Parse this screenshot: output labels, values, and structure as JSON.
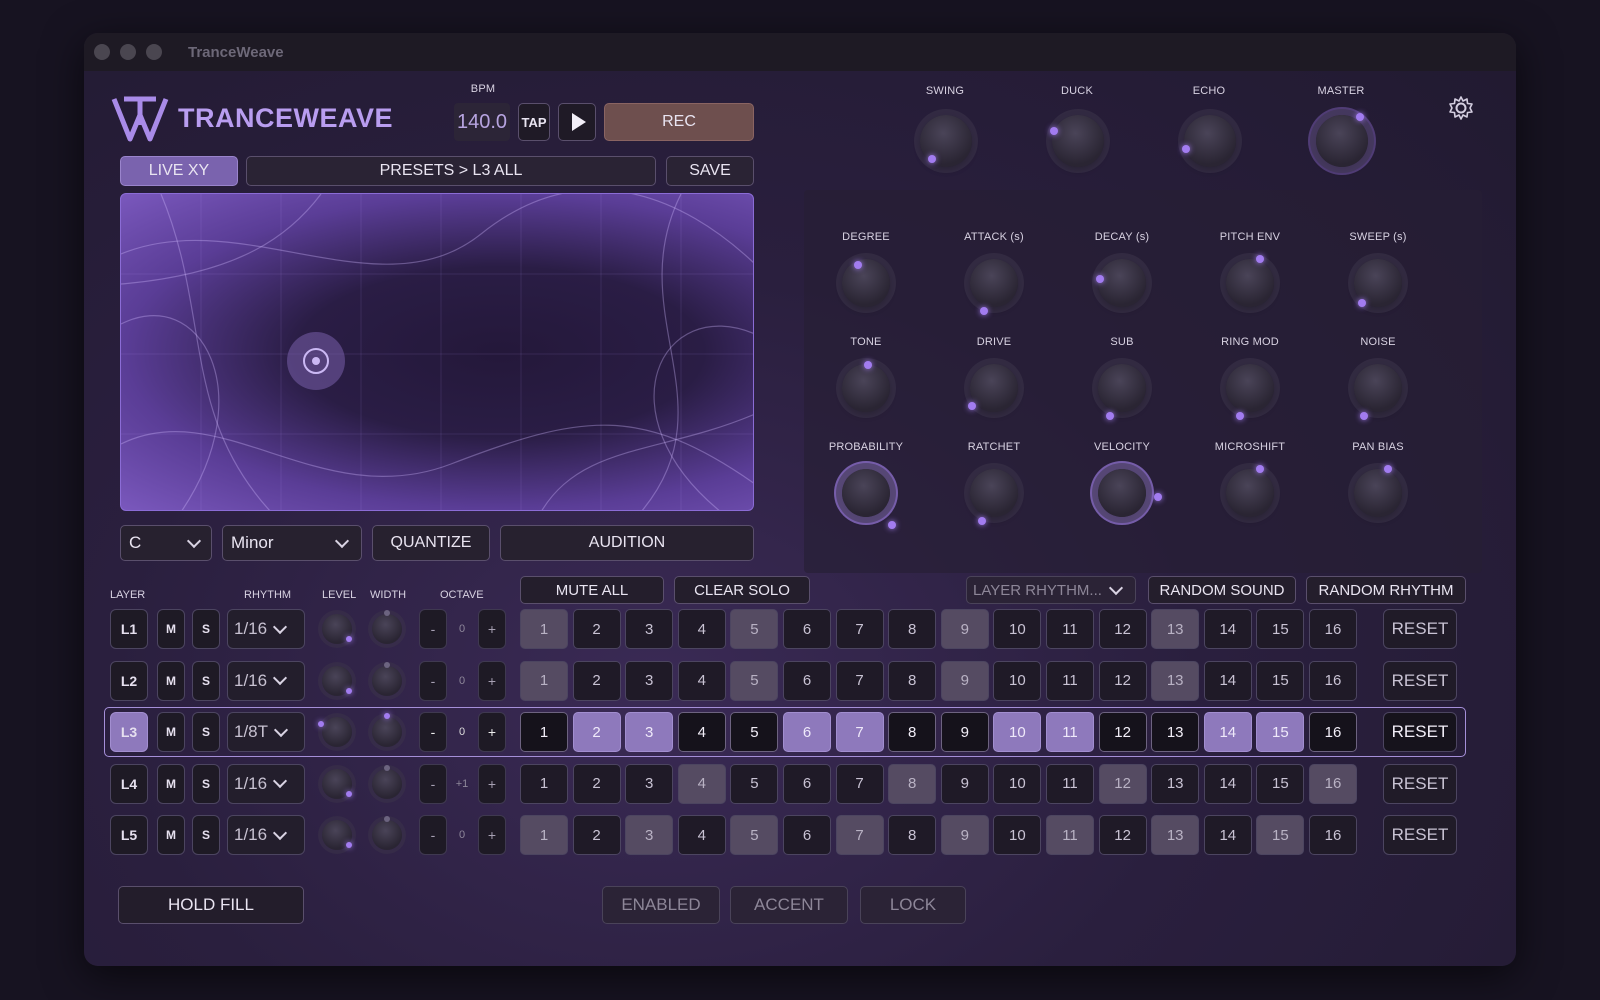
{
  "window": {
    "title": "TranceWeave"
  },
  "brand": {
    "name": "TRANCEWEAVE"
  },
  "transport": {
    "bpm_label": "BPM",
    "bpm_value": "140.0",
    "tap_label": "TAP",
    "rec_label": "REC"
  },
  "mode": {
    "live_xy_label": "LIVE XY",
    "preset_path": "PRESETS > L3 ALL",
    "save_label": "SAVE"
  },
  "global_knobs": {
    "swing": "SWING",
    "duck": "DUCK",
    "echo": "ECHO",
    "master": "MASTER"
  },
  "synth_knobs": {
    "row1": [
      "DEGREE",
      "ATTACK (s)",
      "DECAY (s)",
      "PITCH ENV",
      "SWEEP (s)"
    ],
    "row2": [
      "TONE",
      "DRIVE",
      "SUB",
      "RING MOD",
      "NOISE"
    ],
    "row3": [
      "PROBABILITY",
      "RATCHET",
      "VELOCITY",
      "MICROSHIFT",
      "PAN BIAS"
    ]
  },
  "scale": {
    "key": "C",
    "mode": "Minor",
    "quantize_label": "QUANTIZE",
    "audition_label": "AUDITION"
  },
  "sequencer": {
    "headers": {
      "layer": "LAYER",
      "rhythm": "RHYTHM",
      "level": "LEVEL",
      "width": "WIDTH",
      "octave": "OCTAVE"
    },
    "mute_all": "MUTE ALL",
    "clear_solo": "CLEAR SOLO",
    "layer_rhythm": "LAYER RHYTHM...",
    "random_sound": "RANDOM SOUND",
    "random_rhythm": "RANDOM RHYTHM",
    "minus": "-",
    "plus": "+",
    "mute": "M",
    "solo": "S",
    "reset": "RESET",
    "steps": [
      "1",
      "2",
      "3",
      "4",
      "5",
      "6",
      "7",
      "8",
      "9",
      "10",
      "11",
      "12",
      "13",
      "14",
      "15",
      "16"
    ],
    "layers": [
      {
        "name": "L1",
        "rhythm": "1/16",
        "octave": "0",
        "active": [
          1,
          5,
          9,
          13
        ]
      },
      {
        "name": "L2",
        "rhythm": "1/16",
        "octave": "0",
        "active": [
          1,
          5,
          9,
          13
        ]
      },
      {
        "name": "L3",
        "rhythm": "1/8T",
        "octave": "0",
        "active": [
          2,
          3,
          6,
          7,
          10,
          11,
          14,
          15
        ]
      },
      {
        "name": "L4",
        "rhythm": "1/16",
        "octave": "+1",
        "active": [
          4,
          8,
          12,
          16
        ]
      },
      {
        "name": "L5",
        "rhythm": "1/16",
        "octave": "0",
        "active": [
          1,
          3,
          5,
          7,
          9,
          11,
          13,
          15
        ]
      }
    ]
  },
  "footer": {
    "hold_fill": "HOLD FILL",
    "enabled": "ENABLED",
    "accent": "ACCENT",
    "lock": "LOCK"
  },
  "colors": {
    "accent": "#a27cf0",
    "rec": "#7a5555",
    "l3_highlight": "#8e79bc"
  }
}
